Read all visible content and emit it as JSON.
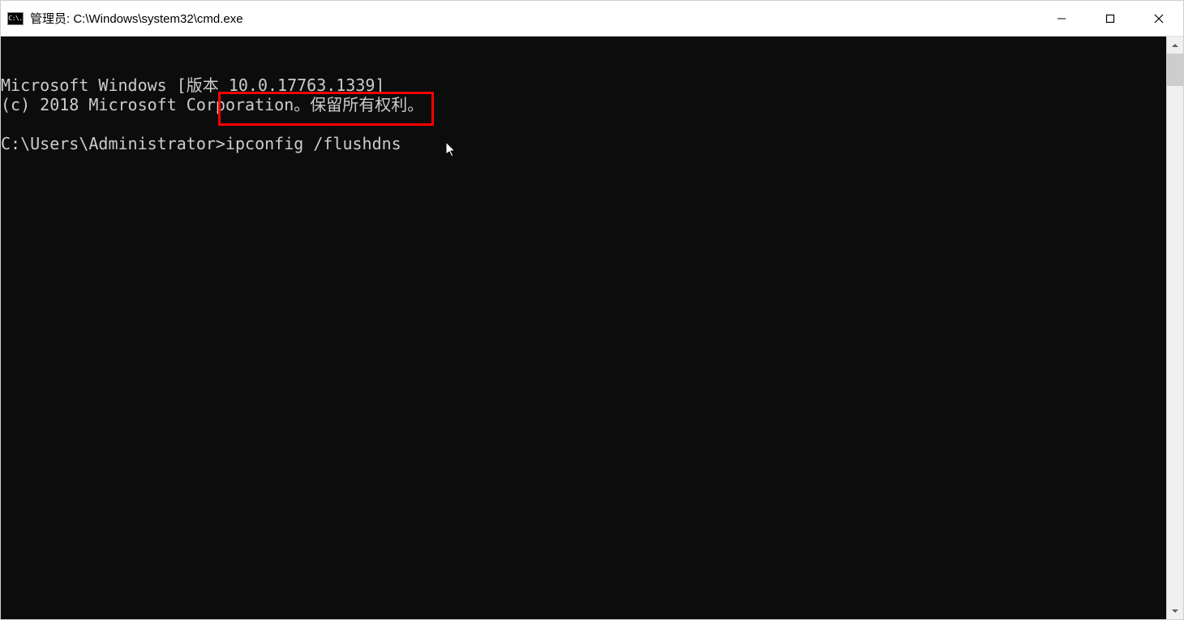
{
  "titlebar": {
    "icon_label": "C:\\.",
    "title": "管理员: C:\\Windows\\system32\\cmd.exe"
  },
  "terminal": {
    "line1": "Microsoft Windows [版本 10.0.17763.1339]",
    "line2": "(c) 2018 Microsoft Corporation。保留所有权利。",
    "prompt": "C:\\Users\\Administrator>",
    "command": "ipconfig /flushdns"
  },
  "annotation": {
    "highlight_color": "#ff0000"
  }
}
